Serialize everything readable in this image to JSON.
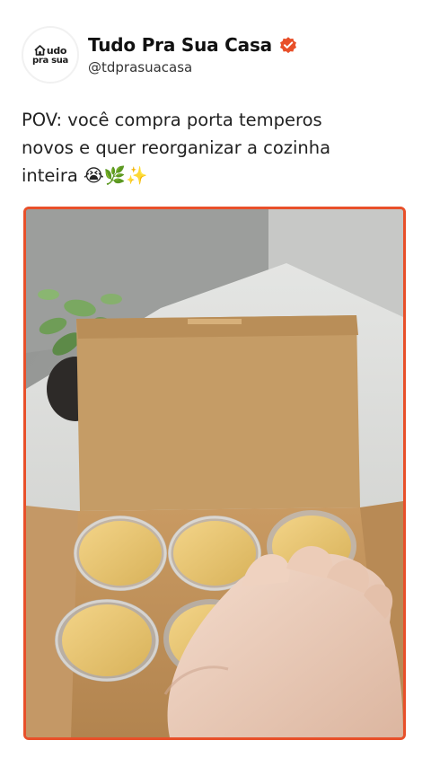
{
  "account": {
    "avatar_logo_line1": "udo",
    "avatar_logo_line2": "pra sua",
    "avatar_logo_full": "Tudo pra sua",
    "display_name": "Tudo Pra Sua Casa",
    "handle": "@tdprasuacasa",
    "verified": true,
    "verified_icon": "verified-badge-icon",
    "accent_color": "#e8502a"
  },
  "post": {
    "caption_line1": "POV: você compra porta temperos",
    "caption_line2": "novos e quer reorganizar a cozinha",
    "caption_line3": "inteira 😭🌿✨"
  },
  "media": {
    "type": "video-frame",
    "subject": "cardboard box with bamboo-lid spice jars wrapped in plastic"
  }
}
